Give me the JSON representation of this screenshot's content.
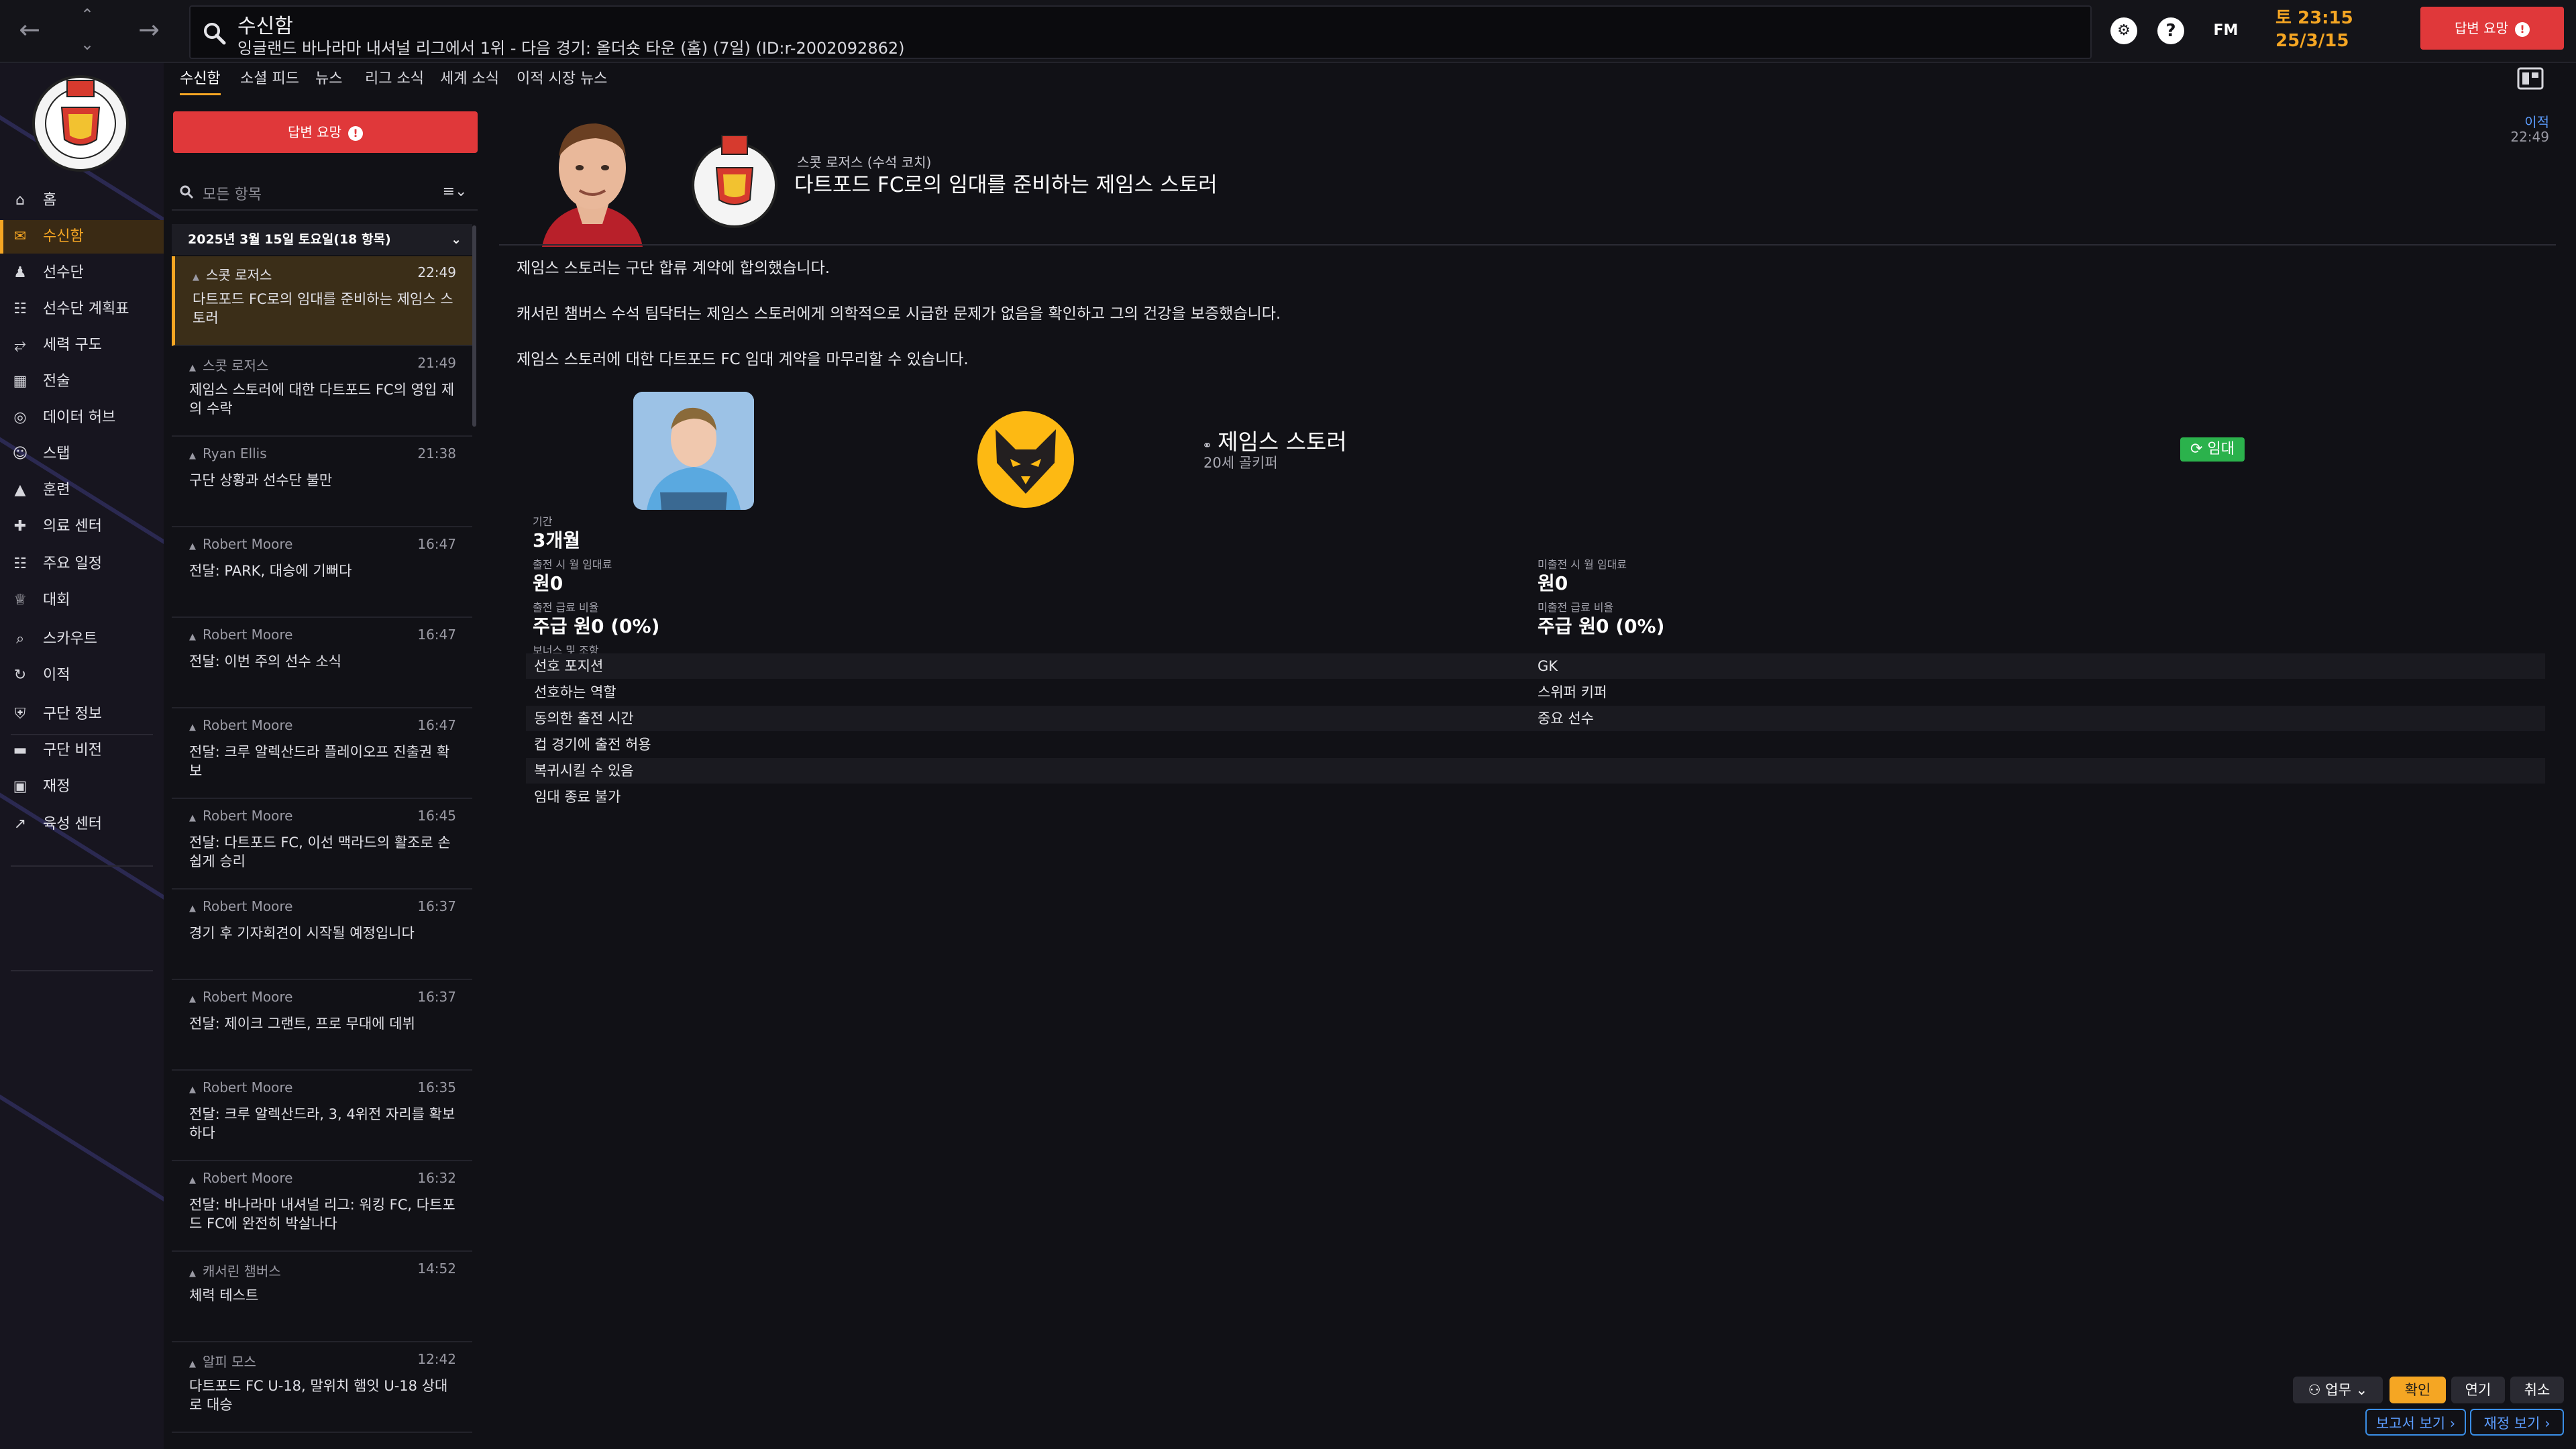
{
  "header": {
    "title": "수신함",
    "subtitle": "잉글랜드 바나라마 내셔널 리그에서 1위 - 다음 경기: 올더숏 타운 (홈) (7일) (ID:r-2002092862)",
    "time": "토 23:15",
    "date": "25/3/15",
    "fm_label": "FM",
    "respond_label": "답변 요망",
    "help_label": "?"
  },
  "sidebar": {
    "items": [
      {
        "label": "홈",
        "icon": "home-icon"
      },
      {
        "label": "수신함",
        "icon": "inbox-icon"
      },
      {
        "label": "선수단",
        "icon": "shirt-icon"
      },
      {
        "label": "선수단 계획표",
        "icon": "clipboard-icon"
      },
      {
        "label": "세력 구도",
        "icon": "dynamics-icon"
      },
      {
        "label": "전술",
        "icon": "tactics-icon"
      },
      {
        "label": "데이터 허브",
        "icon": "data-hub-icon"
      },
      {
        "label": "스탭",
        "icon": "staff-icon"
      },
      {
        "label": "훈련",
        "icon": "training-icon"
      },
      {
        "label": "의료 센터",
        "icon": "medical-icon"
      },
      {
        "label": "주요 일정",
        "icon": "calendar-icon"
      },
      {
        "label": "대회",
        "icon": "trophy-icon"
      },
      {
        "label": "스카우트",
        "icon": "scout-icon"
      },
      {
        "label": "이적",
        "icon": "transfer-icon"
      },
      {
        "label": "구단 정보",
        "icon": "club-info-icon"
      },
      {
        "label": "구단 비전",
        "icon": "vision-icon"
      },
      {
        "label": "재정",
        "icon": "finance-icon"
      },
      {
        "label": "육성 센터",
        "icon": "development-icon"
      }
    ]
  },
  "tabs": [
    "수신함",
    "소셜 피드",
    "뉴스",
    "리그 소식",
    "세계 소식",
    "이적 시장 뉴스"
  ],
  "inbox": {
    "respond_label": "답변 요망",
    "filter_placeholder": "모든 항목",
    "group_header": "2025년 3월 15일 토요일(18 항목)",
    "messages": [
      {
        "from": "스콧 로저스",
        "time": "22:49",
        "subject": "다트포드 FC로의 임대를 준비하는 제임스 스토러"
      },
      {
        "from": "스콧 로저스",
        "time": "21:49",
        "subject": "제임스 스토러에 대한 다트포드 FC의 영입 제의 수락"
      },
      {
        "from": "Ryan Ellis",
        "time": "21:38",
        "subject": "구단 상황과 선수단 불만"
      },
      {
        "from": "Robert Moore",
        "time": "16:47",
        "subject": "전달: PARK, 대승에 기뻐다"
      },
      {
        "from": "Robert Moore",
        "time": "16:47",
        "subject": "전달: 이번 주의 선수 소식"
      },
      {
        "from": "Robert Moore",
        "time": "16:47",
        "subject": "전달: 크루 알렉산드라 플레이오프 진출권 확보"
      },
      {
        "from": "Robert Moore",
        "time": "16:45",
        "subject": "전달: 다트포드 FC, 이선 맥라드의 활조로 손쉽게 승리"
      },
      {
        "from": "Robert Moore",
        "time": "16:37",
        "subject": "경기 후 기자회견이 시작될 예정입니다"
      },
      {
        "from": "Robert Moore",
        "time": "16:37",
        "subject": "전달: 제이크 그랜트, 프로 무대에 데뷔"
      },
      {
        "from": "Robert Moore",
        "time": "16:35",
        "subject": "전달: 크루 알렉산드라, 3, 4위전 자리를 확보하다"
      },
      {
        "from": "Robert Moore",
        "time": "16:32",
        "subject": "전달: 바나라마 내셔널 리그: 워킹 FC, 다트포드 FC에 완전히 박살나다"
      },
      {
        "from": "캐서린 챔버스",
        "time": "14:52",
        "subject": "체력 테스트"
      },
      {
        "from": "알피 모스",
        "time": "12:42",
        "subject": "다트포드 FC U-18, 말위치 햄잇 U-18 상대로 대승"
      }
    ]
  },
  "message": {
    "sender": "스콧 로저스 (수석 코치)",
    "title": "다트포드 FC로의 임대를 준비하는 제임스 스토러",
    "arrow_label": "이적",
    "arrow_time": "22:49",
    "paragraphs": [
      "제임스 스토러는 구단 합류 계약에 합의했습니다.",
      "캐서린 챔버스 수석 팀닥터는 제임스 스토러에게 의학적으로 시급한 문제가 없음을 확인하고 그의 건강을 보증했습니다.",
      "제임스 스토러에 대한 다트포드 FC 임대 계약을 마무리할 수 있습니다."
    ],
    "player": {
      "name": "제임스 스토러",
      "sub": "20세 골키퍼",
      "badge": "임대"
    },
    "terms": {
      "duration_label": "기간",
      "duration_value": "3개월",
      "fee_played_label": "출전 시 월 임대료",
      "fee_played_value": "원0",
      "fee_unplayed_label": "미출전 시 월 임대료",
      "fee_unplayed_value": "원0",
      "wage_played_label": "출전 급료 비율",
      "wage_played_value": "주급 원0 (0%)",
      "wage_unplayed_label": "미출전 급료 비율",
      "wage_unplayed_value": "주급 원0 (0%)",
      "options_label": "보너스 및 조항"
    },
    "rows": [
      {
        "label": "선호 포지션",
        "value": "GK"
      },
      {
        "label": "선호하는 역할",
        "value": "스위퍼 키퍼"
      },
      {
        "label": "동의한 출전 시간",
        "value": "중요 선수"
      },
      {
        "label": "컵 경기에 출전 허용",
        "value": ""
      },
      {
        "label": "복귀시킬 수 있음",
        "value": ""
      },
      {
        "label": "임대 종료 불가",
        "value": ""
      }
    ]
  },
  "footer": {
    "duties_label": "업무",
    "confirm_label": "확인",
    "delay_label": "연기",
    "cancel_label": "취소",
    "report_label": "보고서 보기",
    "finance_label": "재정 보기"
  },
  "colors": {
    "accent": "#f5a623",
    "respond": "#e0383a",
    "loan_badge": "#2bb24c",
    "background": "#111116"
  }
}
